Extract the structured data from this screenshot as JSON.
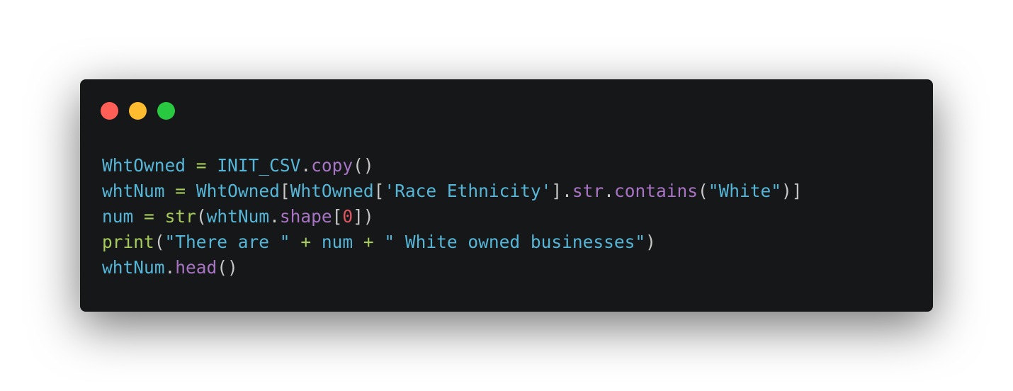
{
  "colors": {
    "background": "#ffffff",
    "window": "#161718",
    "dot_close": "#ff5f57",
    "dot_minimize": "#febc2e",
    "dot_maximize": "#28c840",
    "identifier": "#56b6d8",
    "operator": "#a6cc5b",
    "method": "#a874c4",
    "punct": "#c8c8c8",
    "number": "#e05561",
    "string": "#56b6d8"
  },
  "window_controls": [
    {
      "name": "close",
      "color": "#ff5f57"
    },
    {
      "name": "minimize",
      "color": "#febc2e"
    },
    {
      "name": "maximize",
      "color": "#28c840"
    }
  ],
  "code_lines": [
    {
      "tokens": [
        {
          "t": "WhtOwned",
          "k": "identifier"
        },
        {
          "t": " ",
          "k": "punct"
        },
        {
          "t": "=",
          "k": "operator"
        },
        {
          "t": " ",
          "k": "punct"
        },
        {
          "t": "INIT_CSV",
          "k": "identifier"
        },
        {
          "t": ".",
          "k": "punct"
        },
        {
          "t": "copy",
          "k": "method"
        },
        {
          "t": "()",
          "k": "punct"
        }
      ]
    },
    {
      "tokens": [
        {
          "t": "whtNum",
          "k": "identifier"
        },
        {
          "t": " ",
          "k": "punct"
        },
        {
          "t": "=",
          "k": "operator"
        },
        {
          "t": " ",
          "k": "punct"
        },
        {
          "t": "WhtOwned",
          "k": "identifier"
        },
        {
          "t": "[",
          "k": "punct"
        },
        {
          "t": "WhtOwned",
          "k": "identifier"
        },
        {
          "t": "[",
          "k": "punct"
        },
        {
          "t": "'Race Ethnicity'",
          "k": "string"
        },
        {
          "t": "].",
          "k": "punct"
        },
        {
          "t": "str",
          "k": "method"
        },
        {
          "t": ".",
          "k": "punct"
        },
        {
          "t": "contains",
          "k": "method"
        },
        {
          "t": "(",
          "k": "punct"
        },
        {
          "t": "\"White\"",
          "k": "string"
        },
        {
          "t": ")]",
          "k": "punct"
        }
      ]
    },
    {
      "tokens": [
        {
          "t": "num",
          "k": "identifier"
        },
        {
          "t": " ",
          "k": "punct"
        },
        {
          "t": "=",
          "k": "operator"
        },
        {
          "t": " ",
          "k": "punct"
        },
        {
          "t": "str",
          "k": "operator"
        },
        {
          "t": "(",
          "k": "punct"
        },
        {
          "t": "whtNum",
          "k": "identifier"
        },
        {
          "t": ".",
          "k": "punct"
        },
        {
          "t": "shape",
          "k": "method"
        },
        {
          "t": "[",
          "k": "punct"
        },
        {
          "t": "0",
          "k": "number"
        },
        {
          "t": "])",
          "k": "punct"
        }
      ]
    },
    {
      "tokens": [
        {
          "t": "print",
          "k": "operator"
        },
        {
          "t": "(",
          "k": "punct"
        },
        {
          "t": "\"There are \"",
          "k": "string"
        },
        {
          "t": " ",
          "k": "punct"
        },
        {
          "t": "+",
          "k": "operator"
        },
        {
          "t": " ",
          "k": "punct"
        },
        {
          "t": "num",
          "k": "identifier"
        },
        {
          "t": " ",
          "k": "punct"
        },
        {
          "t": "+",
          "k": "operator"
        },
        {
          "t": " ",
          "k": "punct"
        },
        {
          "t": "\" White owned businesses\"",
          "k": "string"
        },
        {
          "t": ")",
          "k": "punct"
        }
      ]
    },
    {
      "tokens": [
        {
          "t": "whtNum",
          "k": "identifier"
        },
        {
          "t": ".",
          "k": "punct"
        },
        {
          "t": "head",
          "k": "method"
        },
        {
          "t": "()",
          "k": "punct"
        }
      ]
    }
  ]
}
